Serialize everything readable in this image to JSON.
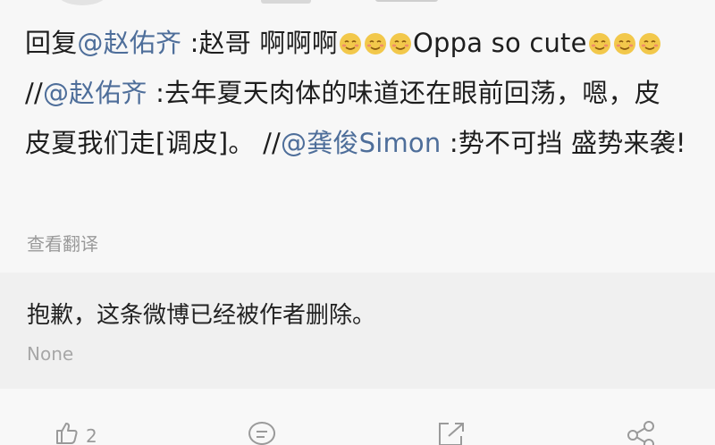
{
  "comment": {
    "reply_prefix": "回复",
    "mention_1": "@赵佑齐",
    "text_1": " :赵哥 啊啊啊",
    "text_2": "Oppa so cute",
    "separator_1": "//",
    "mention_2": "@赵佑齐",
    "text_3": " :去年夏天肉体的味道还在眼前回荡，嗯，皮皮夏我们走[调皮]。",
    "separator_2": "//",
    "mention_3": "@龚俊Simon",
    "text_4": " :势不可挡 盛势来袭!"
  },
  "translate_link": "查看翻译",
  "deleted_notice": {
    "text": "抱歉，这条微博已经被作者删除。",
    "subtext": "None"
  },
  "actions": {
    "like_count": "2"
  },
  "icons": {
    "emoji": "blush-emoji-icon",
    "like": "thumbs-up-icon",
    "comment": "comment-bubble-icon",
    "repost": "repost-icon",
    "share": "share-icon"
  },
  "colors": {
    "mention": "#4e6e9a",
    "text": "#1e1e1e",
    "secondary": "#9a9a9a",
    "emoji_fill": "#f2c84b"
  }
}
